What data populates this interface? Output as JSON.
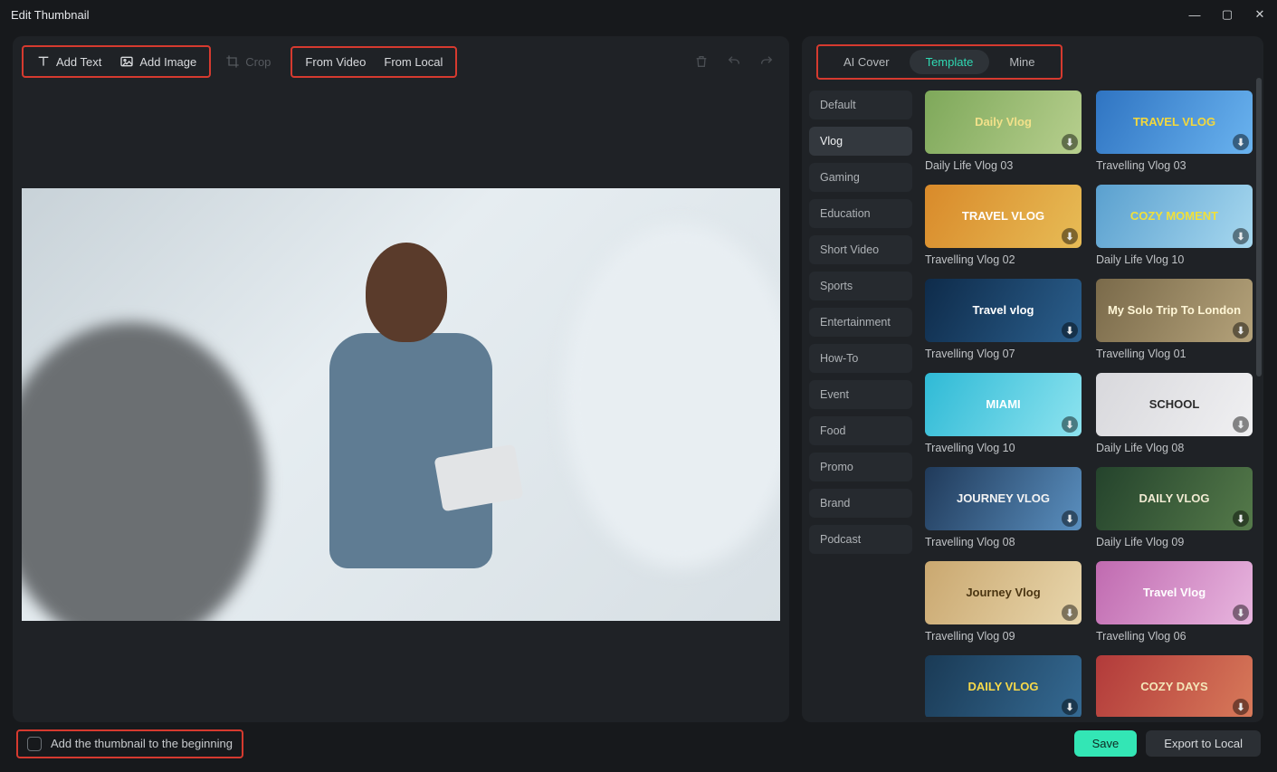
{
  "window": {
    "title": "Edit Thumbnail"
  },
  "toolbar": {
    "add_text": "Add Text",
    "add_image": "Add Image",
    "crop": "Crop",
    "from_video": "From Video",
    "from_local": "From Local"
  },
  "right": {
    "tabs": {
      "ai_cover": "AI Cover",
      "template": "Template",
      "mine": "Mine"
    },
    "active_tab": "Template",
    "categories": [
      "Default",
      "Vlog",
      "Gaming",
      "Education",
      "Short Video",
      "Sports",
      "Entertainment",
      "How-To",
      "Event",
      "Food",
      "Promo",
      "Brand",
      "Podcast"
    ],
    "active_category": "Vlog",
    "templates": [
      {
        "label": "Daily Life Vlog 03",
        "overlay": "Daily Vlog",
        "bg": "linear-gradient(120deg,#7ea85a,#b7cf8e)",
        "color": "#f2e18a"
      },
      {
        "label": "Travelling Vlog 03",
        "overlay": "TRAVEL VLOG",
        "bg": "linear-gradient(120deg,#2f74c2,#6ab3ef)",
        "color": "#f4d83c"
      },
      {
        "label": "Travelling Vlog 02",
        "overlay": "TRAVEL VLOG",
        "bg": "linear-gradient(120deg,#d98a2a,#e7bc56)",
        "color": "#ffffff"
      },
      {
        "label": "Daily Life Vlog 10",
        "overlay": "COZY MOMENT",
        "bg": "linear-gradient(120deg,#5aa0cf,#a7d8ef)",
        "color": "#f0e03a"
      },
      {
        "label": "Travelling Vlog 07",
        "overlay": "Travel vlog",
        "bg": "linear-gradient(120deg,#0e2b4a,#2b5f8d)",
        "color": "#ffffff"
      },
      {
        "label": "Travelling Vlog 01",
        "overlay": "My Solo Trip To London",
        "bg": "linear-gradient(120deg,#7a6a4a,#b4a27a)",
        "color": "#fff6d6"
      },
      {
        "label": "Travelling Vlog 10",
        "overlay": "MIAMI",
        "bg": "linear-gradient(120deg,#2fbad6,#8de3ef)",
        "color": "#ffffff"
      },
      {
        "label": "Daily Life Vlog 08",
        "overlay": "SCHOOL",
        "bg": "linear-gradient(120deg,#d8d8dc,#f0f0f2)",
        "color": "#2b2b2b"
      },
      {
        "label": "Travelling Vlog 08",
        "overlay": "JOURNEY VLOG",
        "bg": "linear-gradient(120deg,#203a5a,#5a8fbf)",
        "color": "#f3f3f3"
      },
      {
        "label": "Daily Life Vlog 09",
        "overlay": "DAILY VLOG",
        "bg": "linear-gradient(120deg,#24432c,#557a4a)",
        "color": "#f0ead2"
      },
      {
        "label": "Travelling Vlog 09",
        "overlay": "Journey Vlog",
        "bg": "linear-gradient(120deg,#caa870,#e8d6ac)",
        "color": "#4a3512"
      },
      {
        "label": "Travelling Vlog 06",
        "overlay": "Travel Vlog",
        "bg": "linear-gradient(120deg,#c06ab0,#e8b6df)",
        "color": "#ffffff"
      },
      {
        "label": "",
        "overlay": "DAILY VLOG",
        "bg": "linear-gradient(120deg,#1a3a55,#356a93)",
        "color": "#f7d94a"
      },
      {
        "label": "",
        "overlay": "COZY DAYS",
        "bg": "linear-gradient(120deg,#b23a3a,#d87a5a)",
        "color": "#f4e6b8"
      }
    ]
  },
  "footer": {
    "checkbox_label": "Add the thumbnail to the beginning",
    "save": "Save",
    "export": "Export to Local"
  },
  "highlights": {
    "toolbar_left": true,
    "toolbar_source": true,
    "right_tabs": true,
    "footer_checkbox": true
  }
}
